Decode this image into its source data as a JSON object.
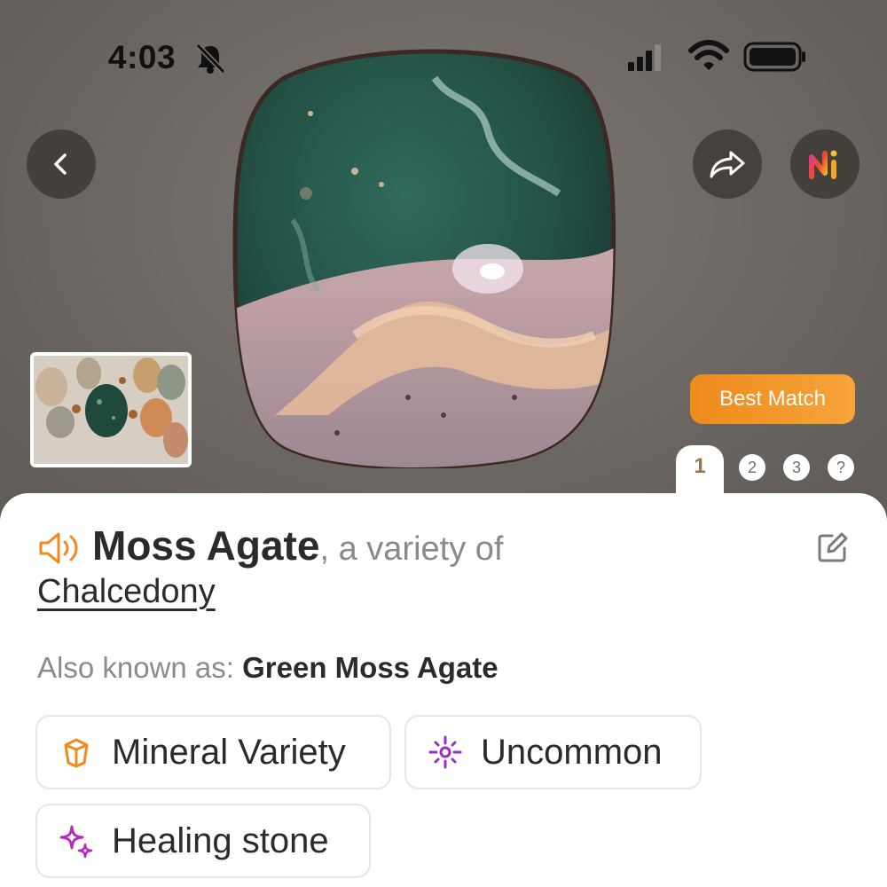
{
  "status_bar": {
    "time": "4:03",
    "icons": [
      "bell-slash-icon",
      "cellular-signal-icon",
      "wifi-icon",
      "battery-icon"
    ]
  },
  "hero": {
    "image": "moss-agate-tumbled-stone-photo",
    "buttons": [
      "back-button",
      "share-button",
      "ai-assistant-button"
    ],
    "best_match_label": "Best Match",
    "pages": {
      "active": "1",
      "others": [
        "2",
        "3",
        "?"
      ]
    }
  },
  "result": {
    "name": "Moss Agate",
    "variety_prefix": ", a variety of",
    "parent_mineral": "Chalcedony",
    "also_known_label": "Also known as: ",
    "also_known_value": "Green Moss Agate",
    "tags": [
      {
        "icon": "crystal-icon",
        "label": "Mineral Variety"
      },
      {
        "icon": "sparkle-icon",
        "label": "Uncommon"
      },
      {
        "icon": "stars-icon",
        "label": "Healing stone"
      }
    ]
  },
  "colors": {
    "accent_orange": "#f08a1e",
    "rarity_purple": "#9b2ec4",
    "healing_magenta": "#b52bbf"
  }
}
